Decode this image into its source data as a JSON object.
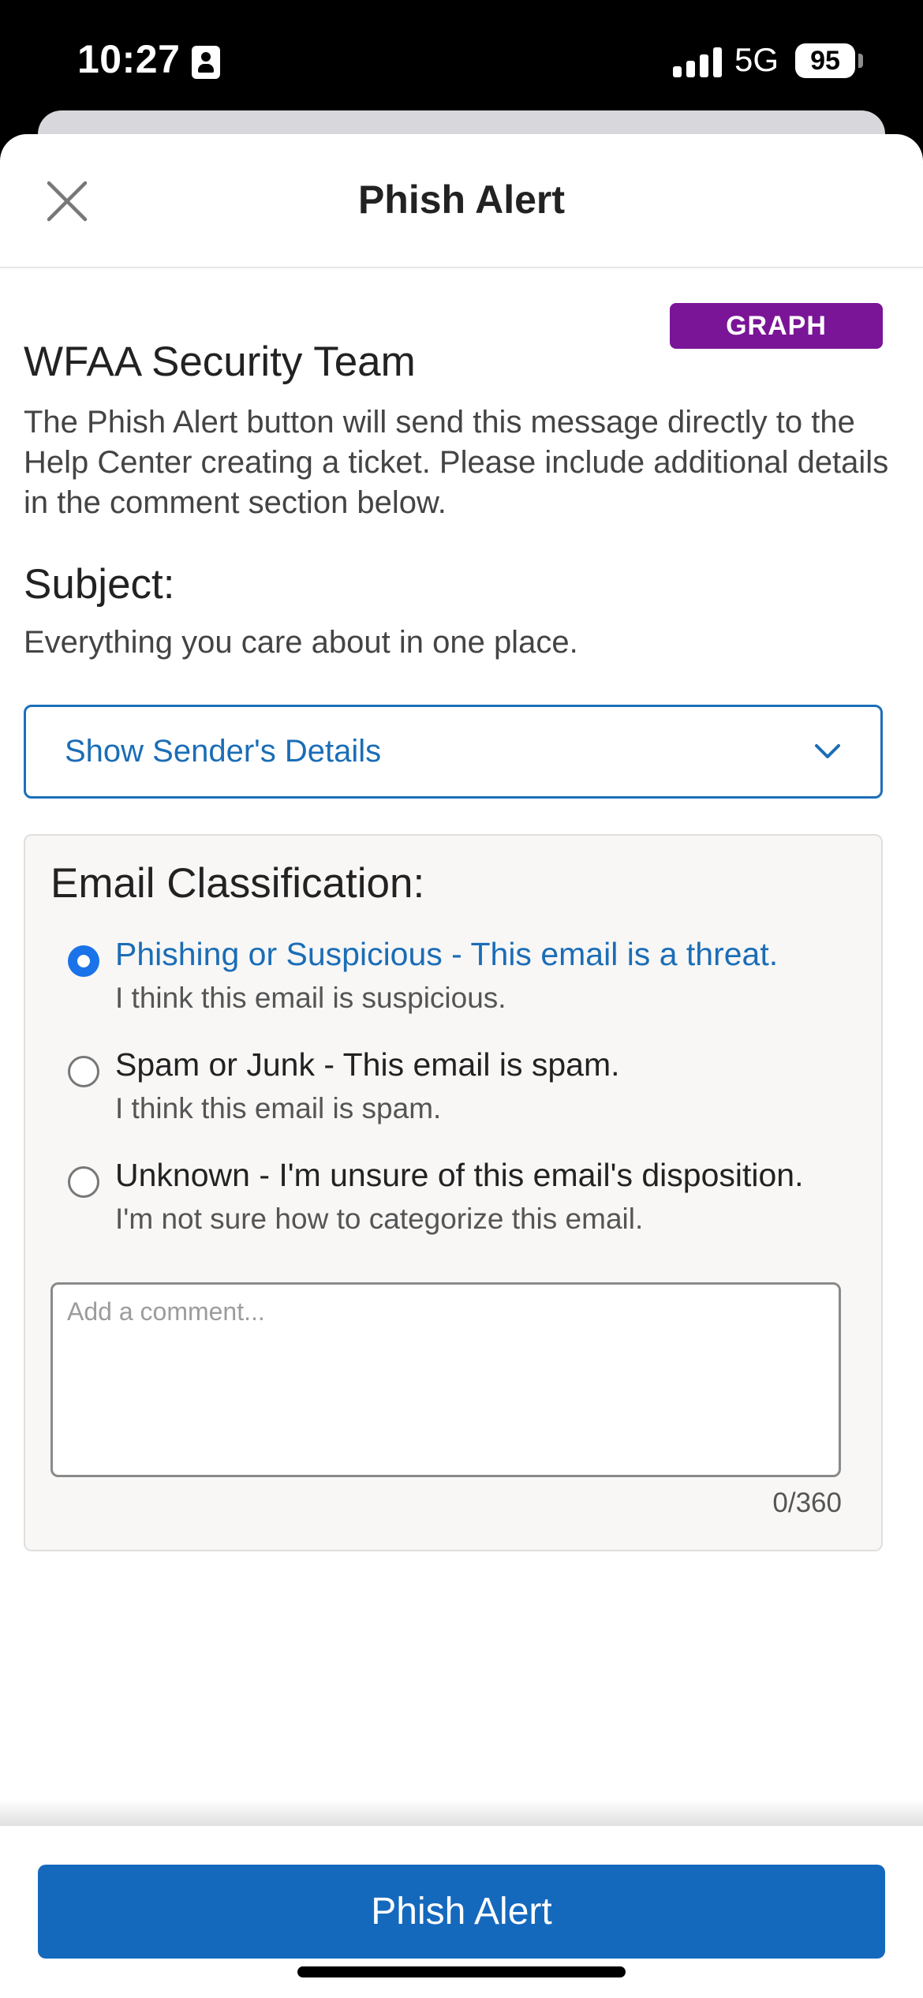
{
  "status_bar": {
    "time": "10:27",
    "network": "5G",
    "battery": "95"
  },
  "header": {
    "title": "Phish Alert",
    "close_icon": "close-icon"
  },
  "badge": {
    "label": "GRAPH",
    "color": "#7a1597"
  },
  "org": {
    "name": "WFAA Security Team",
    "description": "The Phish Alert button will send this message directly to the Help Center creating a ticket. Please include additional details in the comment section below."
  },
  "subject": {
    "label": "Subject:",
    "value": "Everything you care about in one place."
  },
  "sender_details": {
    "label": "Show Sender's Details",
    "icon": "chevron-down-icon"
  },
  "classification": {
    "title": "Email Classification:",
    "options": [
      {
        "label": "Phishing or Suspicious - This email is a threat.",
        "description": "I think this email is suspicious.",
        "selected": true
      },
      {
        "label": "Spam or Junk - This email is spam.",
        "description": "I think this email is spam.",
        "selected": false
      },
      {
        "label": "Unknown - I'm unsure of this email's disposition.",
        "description": "I'm not sure how to categorize this email.",
        "selected": false
      }
    ],
    "comment_placeholder": "Add a comment...",
    "comment_value": "",
    "char_count": "0/360"
  },
  "footer": {
    "button_label": "Phish Alert"
  },
  "colors": {
    "accent": "#1569bd",
    "link": "#1b6db6",
    "radio_selected": "#1a73e8",
    "badge": "#7a1597"
  }
}
